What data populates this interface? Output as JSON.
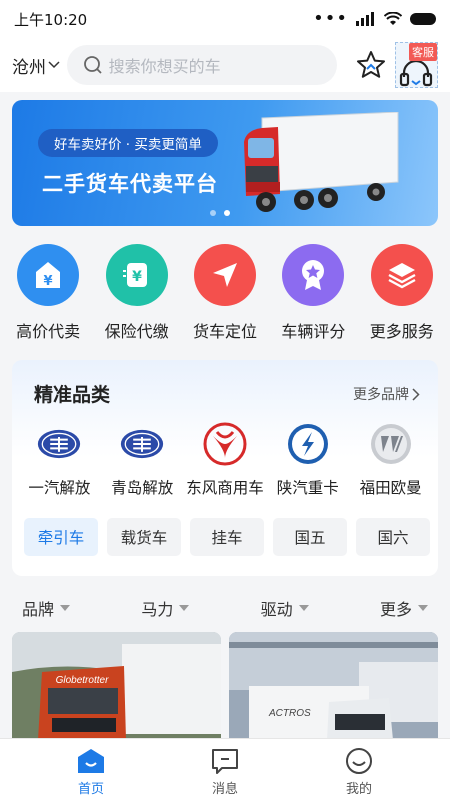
{
  "status_bar": {
    "time": "上午10:20",
    "signal_dots": "•••",
    "network": "ııll"
  },
  "topbar": {
    "city": "沧州",
    "search_placeholder": "搜索你想买的车",
    "service_badge": "客服",
    "icons": [
      "chevron-down-icon",
      "search-icon",
      "star-icon",
      "headset-icon"
    ]
  },
  "banner": {
    "pill_text": "好车卖好价 · 买卖更简单",
    "title": "二手货车代卖平台",
    "colors": {
      "start": "#1d7ae6",
      "end": "#8cc6fb",
      "truck_cab": "#d62a2a"
    }
  },
  "features": [
    {
      "label": "高价代卖",
      "icon": "price-tag-icon",
      "color": "#2f8ff0"
    },
    {
      "label": "保险代缴",
      "icon": "insurance-icon",
      "color": "#20c1a8"
    },
    {
      "label": "货车定位",
      "icon": "location-arrow-icon",
      "color": "#f4504d"
    },
    {
      "label": "车辆评分",
      "icon": "medal-icon",
      "color": "#8c6bf0"
    },
    {
      "label": "更多服务",
      "icon": "layers-icon",
      "color": "#f4504d"
    }
  ],
  "category": {
    "title": "精准品类",
    "more_label": "更多品牌",
    "brands": [
      {
        "label": "一汽解放",
        "icon": "faw-logo-icon"
      },
      {
        "label": "青岛解放",
        "icon": "faw-logo-icon"
      },
      {
        "label": "东风商用车",
        "icon": "dongfeng-logo-icon"
      },
      {
        "label": "陕汽重卡",
        "icon": "shacman-logo-icon"
      },
      {
        "label": "福田欧曼",
        "icon": "foton-logo-icon"
      }
    ],
    "types": [
      "牵引车",
      "载货车",
      "挂车",
      "国五",
      "国六"
    ],
    "active_type": "牵引车"
  },
  "filters": [
    "品牌",
    "马力",
    "驱动",
    "更多"
  ],
  "listings": [
    {
      "photo": "truck-photo-globetrotter",
      "cab_text": "Globetrotter"
    },
    {
      "photo": "truck-photo-actros",
      "cab_text": "ACTROS"
    }
  ],
  "bottom_nav": [
    {
      "label": "首页",
      "icon": "home-icon",
      "active": true
    },
    {
      "label": "消息",
      "icon": "message-icon",
      "active": false
    },
    {
      "label": "我的",
      "icon": "profile-icon",
      "active": false
    }
  ],
  "accent_color": "#1d7ae6"
}
